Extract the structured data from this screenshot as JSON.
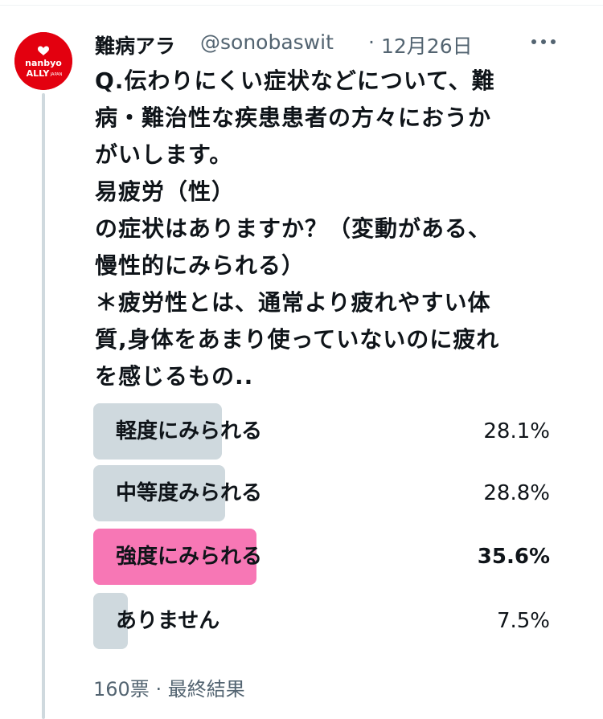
{
  "account": {
    "avatar_icon": "nanbyo-ally-japan-logo",
    "avatar_text_line1": "nanbyo",
    "avatar_text_line2": "ALLY",
    "avatar_text_line3": "JAPAN",
    "display_name": "難病アラ",
    "handle": "@sonobaswit",
    "separator": "·",
    "date": "12月26日",
    "more_icon": "more-horizontal-icon"
  },
  "tweet": {
    "lines": [
      "Q.伝わりにくい症状などについて、難",
      "病・難治性な疾患患者の方々におうか",
      "がいします。",
      "易疲労（性）",
      "の症状はありますか？（変動がある、",
      "慢性的にみられる）",
      "＊疲労性とは、通常より疲れやすい体",
      "質,身体をあまり使っていないのに疲れ",
      "を感じるもの.."
    ]
  },
  "poll": {
    "options": [
      {
        "label": "軽度にみられる",
        "percent": "28.1%",
        "value": 28.1,
        "winner": false
      },
      {
        "label": "中等度みられる",
        "percent": "28.8%",
        "value": 28.8,
        "winner": false
      },
      {
        "label": "強度にみられる",
        "percent": "35.6%",
        "value": 35.6,
        "winner": true
      },
      {
        "label": "ありません",
        "percent": "7.5%",
        "value": 7.5,
        "winner": false
      }
    ],
    "votes": "160票",
    "separator": "·",
    "status": "最終結果"
  },
  "colors": {
    "bar_default": "#cfd9de",
    "bar_winner": "#f777b5",
    "avatar_red": "#e3000f",
    "secondary_text": "#536471"
  }
}
